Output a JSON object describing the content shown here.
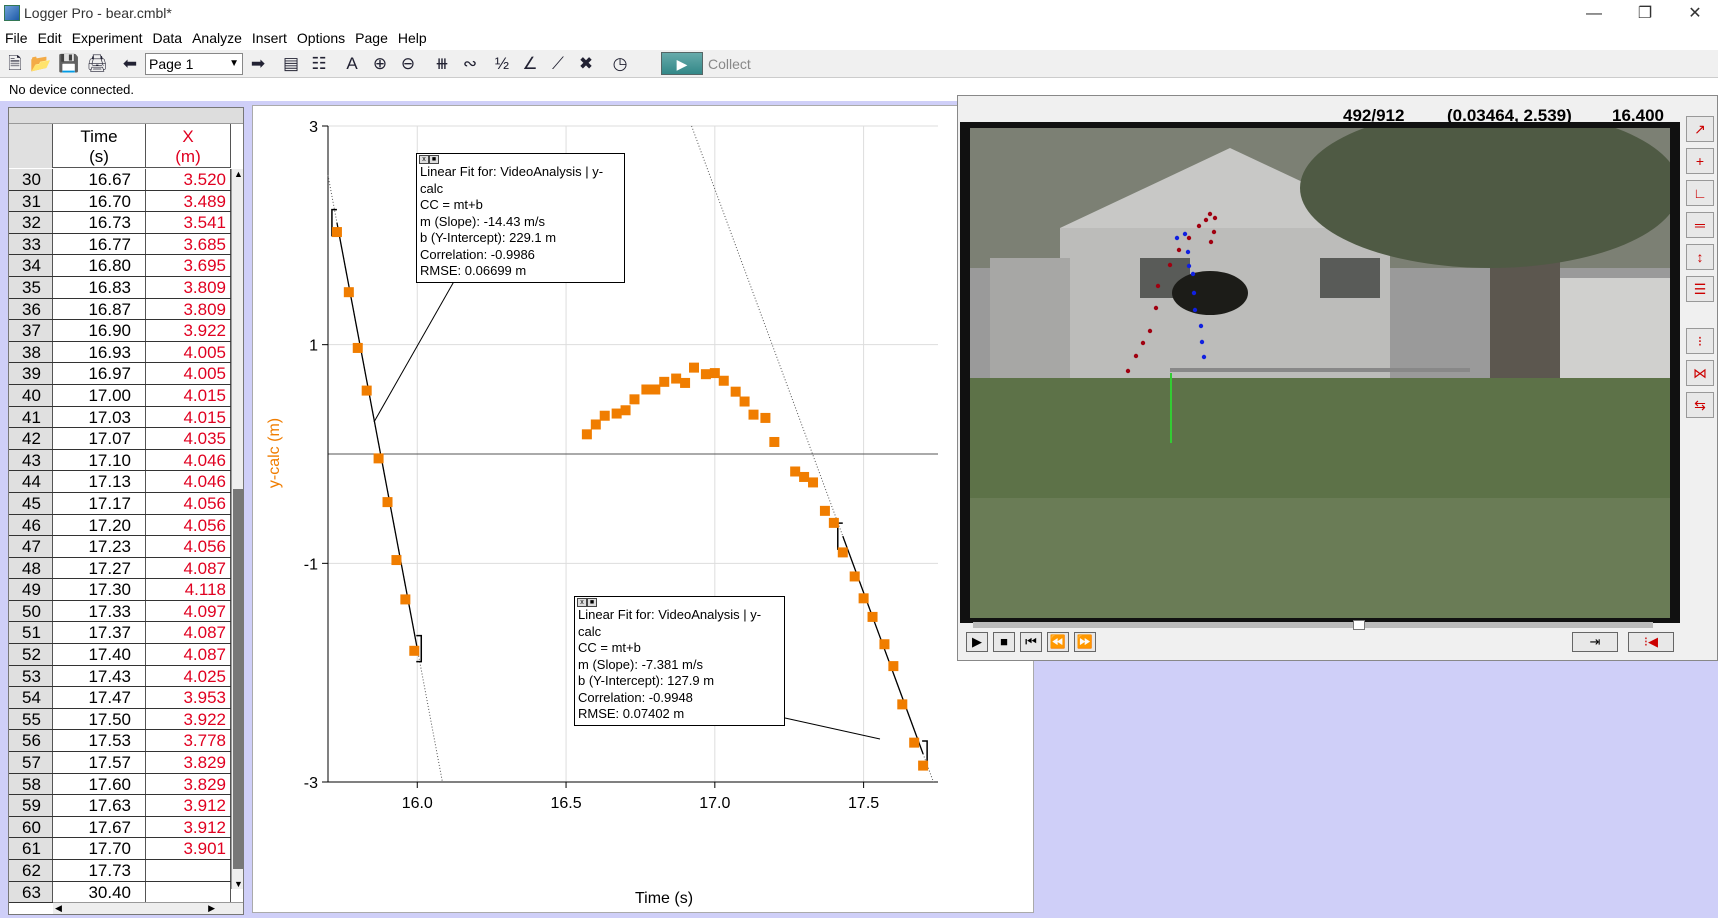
{
  "window": {
    "title": "Logger Pro - bear.cmbl*"
  },
  "menu": [
    "File",
    "Edit",
    "Experiment",
    "Data",
    "Analyze",
    "Insert",
    "Options",
    "Page",
    "Help"
  ],
  "toolbar": {
    "page_select": "Page 1",
    "collect_label": "Collect"
  },
  "status": {
    "text": "No device connected."
  },
  "table": {
    "columns": [
      {
        "name": "Time",
        "unit": "(s)"
      },
      {
        "name": "X",
        "unit": "(m)"
      }
    ],
    "rows": [
      [
        "30",
        "16.67",
        "3.520"
      ],
      [
        "31",
        "16.70",
        "3.489"
      ],
      [
        "32",
        "16.73",
        "3.541"
      ],
      [
        "33",
        "16.77",
        "3.685"
      ],
      [
        "34",
        "16.80",
        "3.695"
      ],
      [
        "35",
        "16.83",
        "3.809"
      ],
      [
        "36",
        "16.87",
        "3.809"
      ],
      [
        "37",
        "16.90",
        "3.922"
      ],
      [
        "38",
        "16.93",
        "4.005"
      ],
      [
        "39",
        "16.97",
        "4.005"
      ],
      [
        "40",
        "17.00",
        "4.015"
      ],
      [
        "41",
        "17.03",
        "4.015"
      ],
      [
        "42",
        "17.07",
        "4.035"
      ],
      [
        "43",
        "17.10",
        "4.046"
      ],
      [
        "44",
        "17.13",
        "4.046"
      ],
      [
        "45",
        "17.17",
        "4.056"
      ],
      [
        "46",
        "17.20",
        "4.056"
      ],
      [
        "47",
        "17.23",
        "4.056"
      ],
      [
        "48",
        "17.27",
        "4.087"
      ],
      [
        "49",
        "17.30",
        "4.118"
      ],
      [
        "50",
        "17.33",
        "4.097"
      ],
      [
        "51",
        "17.37",
        "4.087"
      ],
      [
        "52",
        "17.40",
        "4.087"
      ],
      [
        "53",
        "17.43",
        "4.025"
      ],
      [
        "54",
        "17.47",
        "3.953"
      ],
      [
        "55",
        "17.50",
        "3.922"
      ],
      [
        "56",
        "17.53",
        "3.778"
      ],
      [
        "57",
        "17.57",
        "3.829"
      ],
      [
        "58",
        "17.60",
        "3.829"
      ],
      [
        "59",
        "17.63",
        "3.912"
      ],
      [
        "60",
        "17.67",
        "3.912"
      ],
      [
        "61",
        "17.70",
        "3.901"
      ],
      [
        "62",
        "17.73",
        ""
      ],
      [
        "63",
        "30.40",
        ""
      ]
    ]
  },
  "graph": {
    "ylabel": "y-calc (m)",
    "xlabel": "Time (s)",
    "yticks": [
      "3",
      "1",
      "-1",
      "-3"
    ],
    "xticks": [
      "16.0",
      "16.5",
      "17.0",
      "17.5"
    ],
    "fit1": {
      "title": "Linear Fit for: VideoAnalysis | y-calc",
      "eq": "CC = mt+b",
      "slope": "m (Slope): -14.43 m/s",
      "intercept": "b (Y-Intercept): 229.1 m",
      "corr": "Correlation: -0.9986",
      "rmse": "RMSE: 0.06699 m"
    },
    "fit2": {
      "title": "Linear Fit for: VideoAnalysis | y-calc",
      "eq": "CC = mt+b",
      "slope": "m (Slope): -7.381 m/s",
      "intercept": "b (Y-Intercept): 127.9 m",
      "corr": "Correlation: -0.9948",
      "rmse": "RMSE: 0.07402 m"
    }
  },
  "chart_data": {
    "type": "scatter",
    "xlabel": "Time (s)",
    "ylabel": "y-calc (m)",
    "xlim": [
      15.7,
      17.75
    ],
    "ylim": [
      -3,
      3
    ],
    "marker_color": "#f07d00",
    "points": [
      [
        15.73,
        2.03
      ],
      [
        15.77,
        1.48
      ],
      [
        15.8,
        0.97
      ],
      [
        15.83,
        0.58
      ],
      [
        15.87,
        -0.04
      ],
      [
        15.9,
        -0.44
      ],
      [
        15.93,
        -0.97
      ],
      [
        15.96,
        -1.33
      ],
      [
        15.99,
        -1.8
      ],
      [
        16.57,
        0.18
      ],
      [
        16.6,
        0.27
      ],
      [
        16.63,
        0.35
      ],
      [
        16.67,
        0.37
      ],
      [
        16.7,
        0.4
      ],
      [
        16.73,
        0.5
      ],
      [
        16.77,
        0.59
      ],
      [
        16.8,
        0.59
      ],
      [
        16.83,
        0.66
      ],
      [
        16.87,
        0.69
      ],
      [
        16.9,
        0.65
      ],
      [
        16.93,
        0.79
      ],
      [
        16.97,
        0.73
      ],
      [
        17.0,
        0.74
      ],
      [
        17.03,
        0.67
      ],
      [
        17.07,
        0.57
      ],
      [
        17.1,
        0.48
      ],
      [
        17.13,
        0.36
      ],
      [
        17.17,
        0.33
      ],
      [
        17.2,
        0.11
      ],
      [
        17.27,
        -0.16
      ],
      [
        17.3,
        -0.21
      ],
      [
        17.33,
        -0.26
      ],
      [
        17.37,
        -0.52
      ],
      [
        17.4,
        -0.63
      ],
      [
        17.43,
        -0.9
      ],
      [
        17.47,
        -1.12
      ],
      [
        17.5,
        -1.32
      ],
      [
        17.53,
        -1.49
      ],
      [
        17.57,
        -1.74
      ],
      [
        17.6,
        -1.94
      ],
      [
        17.63,
        -2.29
      ],
      [
        17.67,
        -2.64
      ],
      [
        17.7,
        -2.85
      ]
    ],
    "fits": [
      {
        "slope": -14.43,
        "intercept": 229.1,
        "range": [
          15.73,
          16.0
        ]
      },
      {
        "slope": -7.381,
        "intercept": 127.9,
        "range": [
          17.43,
          17.7
        ]
      }
    ]
  },
  "video": {
    "frame_counter": "492/912",
    "coords": "(0.03464, 2.539)",
    "time": "16.400"
  },
  "colors": {
    "workspace": "#cfcff8",
    "data_red": "#e00020",
    "marker": "#f07d00"
  }
}
